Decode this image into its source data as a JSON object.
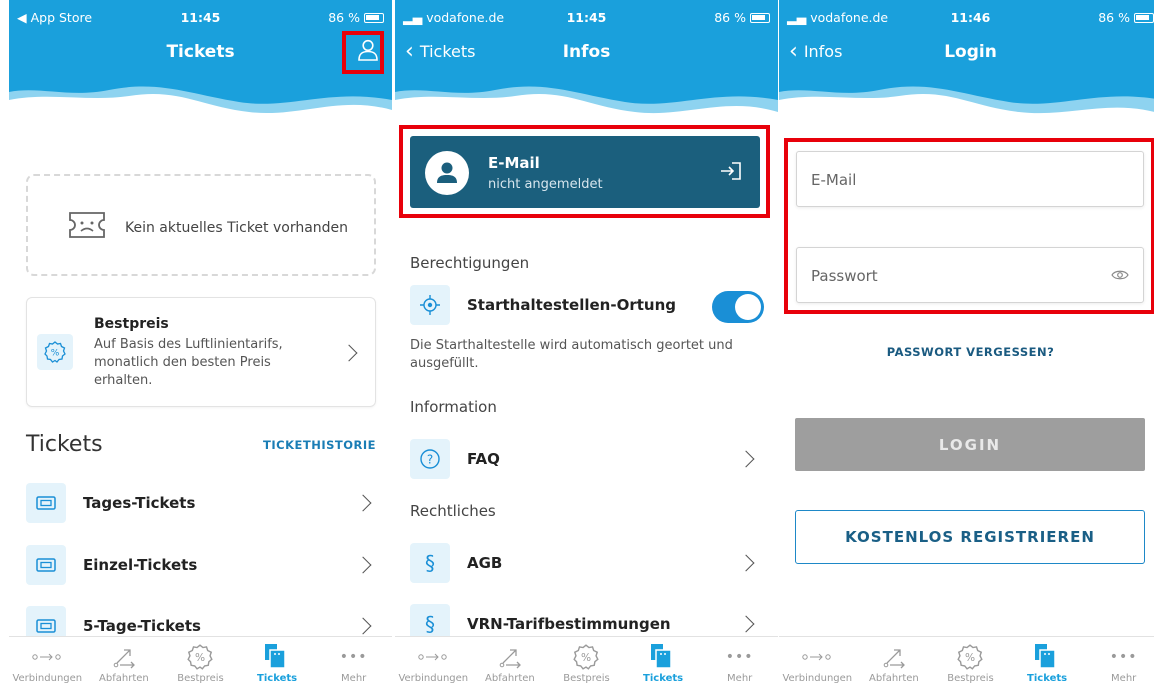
{
  "colors": {
    "header_blue": "#1aa0dc",
    "dark_card": "#1b5f7d",
    "highlight_red": "#e8000a",
    "link_blue": "#1a7db5"
  },
  "tabbar": [
    {
      "label": "Verbindungen",
      "icon": "route-icon"
    },
    {
      "label": "Abfahrten",
      "icon": "departure-icon"
    },
    {
      "label": "Bestpreis",
      "icon": "percent-badge-icon"
    },
    {
      "label": "Tickets",
      "icon": "tickets-icon",
      "active": true
    },
    {
      "label": "Mehr",
      "icon": "more-dots-icon"
    }
  ],
  "screen1": {
    "status": {
      "left": "◀ App Store",
      "time": "11:45",
      "battery": "86 %"
    },
    "title": "Tickets",
    "empty_ticket_text": "Kein aktuelles Ticket vorhanden",
    "bestpreis": {
      "title": "Bestpreis",
      "desc": "Auf Basis des Luftlinientarifs, monatlich den besten Preis erhalten."
    },
    "section_title": "Tickets",
    "section_link": "TICKETHISTORIE",
    "tickets": [
      "Tages-Tickets",
      "Einzel-Tickets",
      "5-Tage-Tickets"
    ]
  },
  "screen2": {
    "status": {
      "left": "vodafone.de",
      "time": "11:45",
      "battery": "86 %"
    },
    "back": "Tickets",
    "title": "Infos",
    "email_card": {
      "title": "E-Mail",
      "subtitle": "nicht angemeldet"
    },
    "berechtigungen": "Berechtigungen",
    "ortung": {
      "label": "Starthaltestellen-Ortung",
      "enabled": true,
      "desc": "Die Starthaltestelle wird automatisch geortet und ausgefüllt."
    },
    "information": "Information",
    "faq": "FAQ",
    "rechtliches": "Rechtliches",
    "agb": "AGB",
    "vrn": "VRN-Tarifbestimmungen",
    "paragraph_glyph": "§"
  },
  "screen3": {
    "status": {
      "left": "vodafone.de",
      "time": "11:46",
      "battery": "86 %"
    },
    "back": "Infos",
    "title": "Login",
    "email_placeholder": "E-Mail",
    "password_placeholder": "Passwort",
    "forgot": "PASSWORT VERGESSEN?",
    "login_button": "LOGIN",
    "register_button": "KOSTENLOS REGISTRIEREN"
  }
}
